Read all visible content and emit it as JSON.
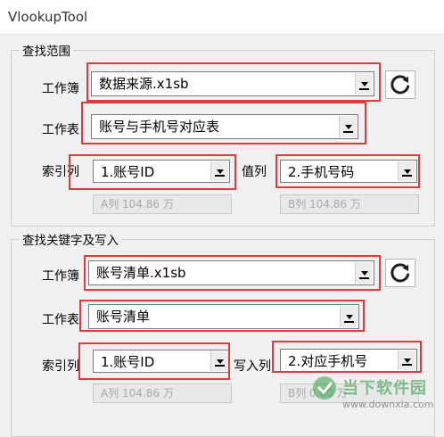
{
  "window": {
    "title": "VlookupTool"
  },
  "search_group": {
    "legend": "查找范围",
    "workbook_label": "工作簿",
    "workbook_value": "数据来源.x1sb",
    "sheet_label": "工作表",
    "sheet_value": "账号与手机号对应表",
    "index_label": "索引列",
    "index_value": "1.账号ID",
    "index_info": "A列 104.86 万",
    "value_label": "值列",
    "value_value": "2.手机号码",
    "value_info": "B列 104.86 万"
  },
  "write_group": {
    "legend": "查找关键字及写入",
    "workbook_label": "工作簿",
    "workbook_value": "账号清单.x1sb",
    "sheet_label": "工作表",
    "sheet_value": "账号清单",
    "index_label": "索引列",
    "index_value": "1.账号ID",
    "index_info": "A列 104.86 万",
    "write_label": "写入列",
    "write_value": "2.对应手机号",
    "write_info": "B列 0.00 万"
  },
  "watermark": {
    "brand": "当下软件园",
    "url": "www.downxia.com"
  },
  "colors": {
    "highlight": "#e23a3a",
    "background": "#f0f0f0",
    "watermark": "#2f9640"
  }
}
